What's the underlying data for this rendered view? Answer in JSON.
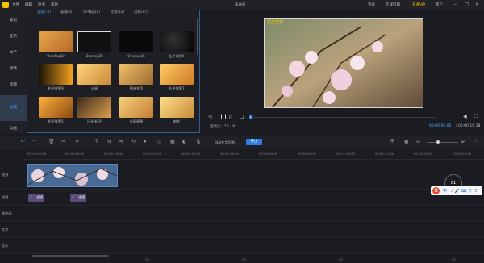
{
  "titlebar": {
    "menu": [
      "文件",
      "编辑",
      "导出",
      "帮助"
    ],
    "title": "未命名",
    "right": [
      "登录",
      "在线剪辑",
      "开通VIP",
      "客户"
    ]
  },
  "left_nav": {
    "items": [
      "素材",
      "配乐",
      "文字",
      "转场",
      "滤镜",
      "滤镜",
      "动画"
    ],
    "active_index": 5
  },
  "media": {
    "tabs": [
      "全部(78)",
      "基础(8)",
      "VIP精选(8)",
      "光效(22)",
      "边框(37)"
    ],
    "items": [
      {
        "label": "Overlay10"
      },
      {
        "label": "Overlay25"
      },
      {
        "label": "Overlay26"
      },
      {
        "label": "粒子效果6"
      },
      {
        "label": "粒子效果9"
      },
      {
        "label": "火星"
      },
      {
        "label": "落叶金币"
      },
      {
        "label": "粒子效果7"
      },
      {
        "label": "粒子效果5"
      },
      {
        "label": "闪光·粒子"
      },
      {
        "label": "光斑星星"
      },
      {
        "label": "电影"
      }
    ]
  },
  "preview": {
    "watermark": "爱剪剪辑",
    "ratio_label": "宽高比：16：9",
    "current_time": "00:00:00.00",
    "total_time": "/ 00:00:16.18"
  },
  "toolbar": {
    "link_label": "自动文字识别",
    "button_label": "导出"
  },
  "ruler": {
    "ticks": [
      "00:00:00:00",
      "00:00:08:00",
      "00:00:16:00",
      "00:00:24:00",
      "00:00:32:00",
      "00:00:40:00",
      "00:00:48:00",
      "00:00:56:00",
      "00:01:04:00",
      "00:01:12:00",
      "00:01:20:00",
      "00:01:28:00"
    ]
  },
  "tracks": [
    {
      "label": "视频"
    },
    {
      "label": "滤镜"
    },
    {
      "label": "画中画"
    },
    {
      "label": "文字"
    },
    {
      "label": "音乐"
    }
  ],
  "clips": {
    "fx": [
      {
        "label": "滤镜"
      },
      {
        "label": "滤镜"
      }
    ]
  },
  "zoom": {
    "value": "81"
  },
  "ime": {
    "letter": "S",
    "text": "中 · ♪ 🎤 ⌨ 👕 ⠿"
  },
  "colors": {
    "accent": "#4fa3ff",
    "brand": "#f5c400",
    "button": "#2f7de1"
  }
}
